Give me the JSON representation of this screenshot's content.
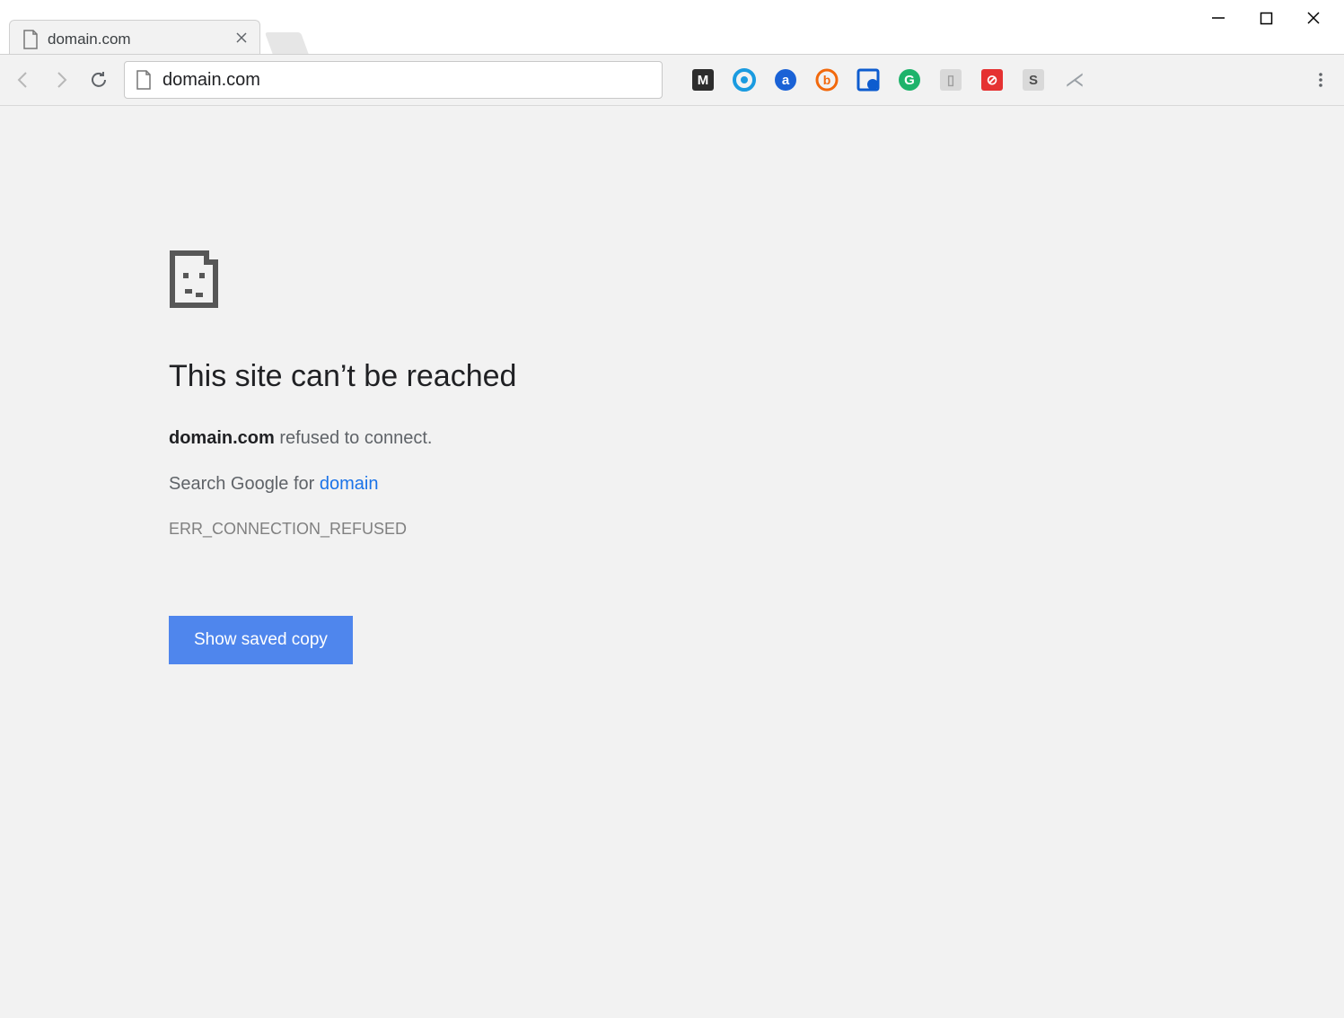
{
  "tab": {
    "title": "domain.com"
  },
  "omnibox": {
    "url": "domain.com"
  },
  "extensions": [
    {
      "id": "ext-m",
      "bg": "#2d2d2d",
      "fg": "#ffffff",
      "label": "M",
      "shape": "square"
    },
    {
      "id": "ext-o1",
      "bg": "#ffffff",
      "fg": "#1a9be0",
      "label": "◎",
      "shape": "circle-ring"
    },
    {
      "id": "ext-a",
      "bg": "#1a62d6",
      "fg": "#ffffff",
      "label": "a",
      "shape": "circle"
    },
    {
      "id": "ext-b",
      "bg": "#ffffff",
      "fg": "#f2690d",
      "label": "b",
      "shape": "circle-outline"
    },
    {
      "id": "ext-pic",
      "bg": "#0d5ccf",
      "fg": "#ffffff",
      "label": "▣",
      "shape": "square-corner"
    },
    {
      "id": "ext-g",
      "bg": "#1eb36b",
      "fg": "#ffffff",
      "label": "G",
      "shape": "circle"
    },
    {
      "id": "ext-pg",
      "bg": "#d9d9d9",
      "fg": "#9e9e9e",
      "label": "▯",
      "shape": "square"
    },
    {
      "id": "ext-red",
      "bg": "#e53232",
      "fg": "#ffffff",
      "label": "⊘",
      "shape": "square"
    },
    {
      "id": "ext-s",
      "bg": "#d9d9d9",
      "fg": "#4d4d4d",
      "label": "S",
      "shape": "square"
    },
    {
      "id": "ext-fork",
      "bg": "#ffffff",
      "fg": "#9aa0a6",
      "label": "⋌",
      "shape": "plain"
    }
  ],
  "error": {
    "title": "This site can’t be reached",
    "host": "domain.com",
    "refused_text": " refused to connect.",
    "search_prefix": "Search Google for ",
    "search_term": "domain",
    "code": "ERR_CONNECTION_REFUSED",
    "button_label": "Show saved copy"
  }
}
